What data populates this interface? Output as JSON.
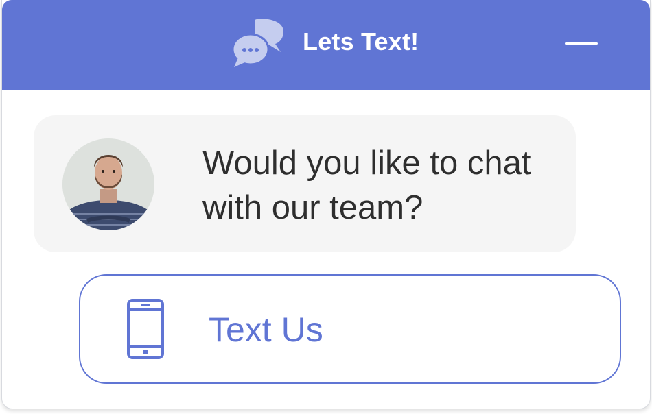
{
  "header": {
    "title": "Lets Text!",
    "icon": "chat-bubbles-icon",
    "minimize_icon": "minimize-icon",
    "background_color": "#6075d4"
  },
  "message": {
    "avatar": "agent-avatar",
    "text": "Would you like to chat with our team?"
  },
  "cta": {
    "label": "Text Us",
    "icon": "phone-icon",
    "accent_color": "#6075d4"
  }
}
